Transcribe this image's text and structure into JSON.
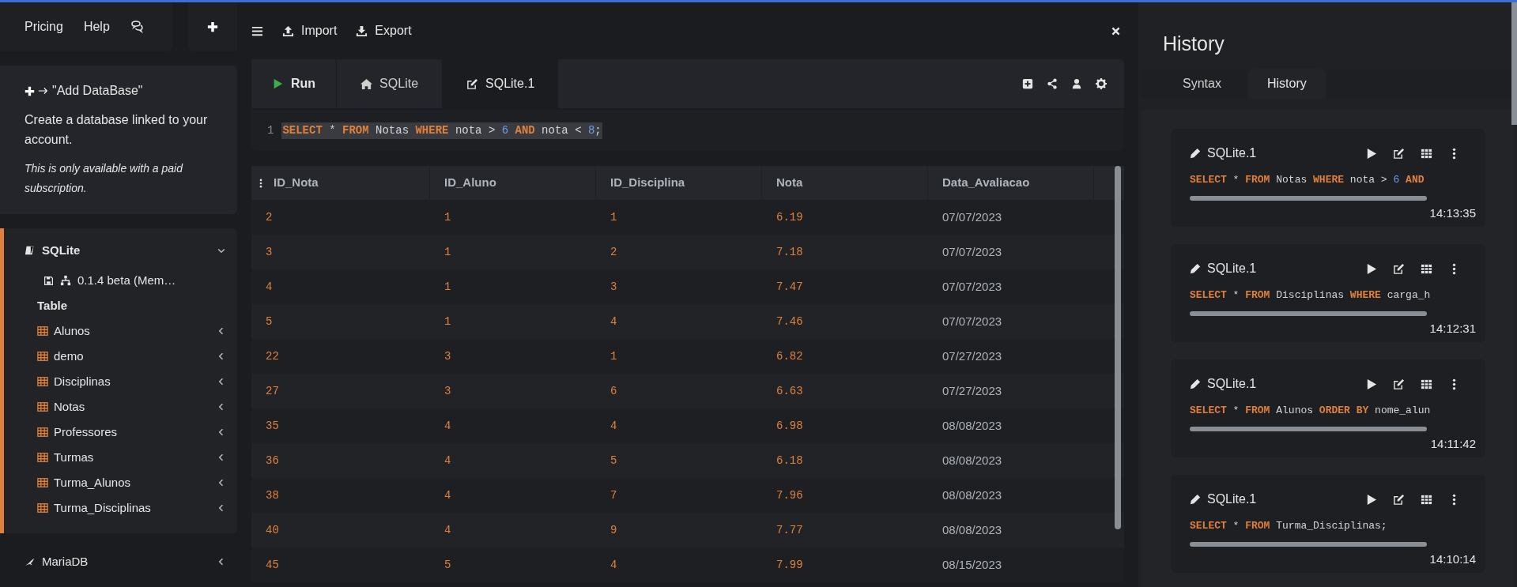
{
  "sidebar": {
    "nav": [
      {
        "kind": "text",
        "label": "Pricing"
      },
      {
        "kind": "text",
        "label": "Help"
      },
      {
        "kind": "icon"
      }
    ],
    "info": {
      "title": "\"Add DataBase\"",
      "text": "Create a database linked to your account.",
      "note": "This is only available with a paid subscription."
    },
    "databases": [
      {
        "name": "SQLite",
        "expanded": true,
        "version": "0.1.4 beta (Mem…",
        "section": "Table",
        "tables": [
          "Alunos",
          "demo",
          "Disciplinas",
          "Notas",
          "Professores",
          "Turmas",
          "Turma_Alunos",
          "Turma_Disciplinas"
        ]
      },
      {
        "name": "MariaDB",
        "expanded": false
      }
    ]
  },
  "toolbar": {
    "buttons": [
      {
        "kind": "import",
        "label": "Import"
      },
      {
        "kind": "export",
        "label": "Export"
      }
    ]
  },
  "editor": {
    "run_label": "Run",
    "tabs": [
      {
        "kind": "home",
        "label": "SQLite",
        "selected": false
      },
      {
        "kind": "edit",
        "label": "SQLite.1",
        "selected": true
      }
    ],
    "line_number": "1",
    "code": [
      {
        "kind": "keyword",
        "text": "SELECT"
      },
      {
        "kind": "text",
        "text": " * "
      },
      {
        "kind": "keyword",
        "text": "FROM"
      },
      {
        "kind": "text",
        "text": " Notas "
      },
      {
        "kind": "keyword",
        "text": "WHERE"
      },
      {
        "kind": "text",
        "text": " nota > "
      },
      {
        "kind": "number",
        "text": "6"
      },
      {
        "kind": "keyword",
        "text": " AND"
      },
      {
        "kind": "text",
        "text": " nota < "
      },
      {
        "kind": "number",
        "text": "8"
      },
      {
        "kind": "text",
        "text": ";"
      }
    ]
  },
  "table": {
    "columns": [
      "ID_Nota",
      "ID_Aluno",
      "ID_Disciplina",
      "Nota",
      "Data_Avaliacao"
    ],
    "rows": [
      [
        "2",
        "1",
        "1",
        "6.19",
        "07/07/2023"
      ],
      [
        "3",
        "1",
        "2",
        "7.18",
        "07/07/2023"
      ],
      [
        "4",
        "1",
        "3",
        "7.47",
        "07/07/2023"
      ],
      [
        "5",
        "1",
        "4",
        "7.46",
        "07/07/2023"
      ],
      [
        "22",
        "3",
        "1",
        "6.82",
        "07/27/2023"
      ],
      [
        "27",
        "3",
        "6",
        "6.63",
        "07/27/2023"
      ],
      [
        "35",
        "4",
        "4",
        "6.98",
        "08/08/2023"
      ],
      [
        "36",
        "4",
        "5",
        "6.18",
        "08/08/2023"
      ],
      [
        "38",
        "4",
        "7",
        "7.96",
        "08/08/2023"
      ],
      [
        "40",
        "4",
        "9",
        "7.77",
        "08/08/2023"
      ],
      [
        "45",
        "5",
        "4",
        "7.99",
        "08/15/2023"
      ]
    ]
  },
  "history": {
    "title": "History",
    "tabs": [
      {
        "label": "Syntax",
        "selected": false
      },
      {
        "label": "History",
        "selected": true
      }
    ],
    "entries": [
      {
        "name": "SQLite.1",
        "time": "14:13:35",
        "code": [
          {
            "kind": "keyword",
            "text": "SELECT"
          },
          {
            "kind": "text",
            "text": " * "
          },
          {
            "kind": "keyword",
            "text": "FROM"
          },
          {
            "kind": "text",
            "text": " Notas "
          },
          {
            "kind": "keyword",
            "text": "WHERE"
          },
          {
            "kind": "text",
            "text": " nota > "
          },
          {
            "kind": "number",
            "text": "6"
          },
          {
            "kind": "keyword",
            "text": " AND"
          }
        ]
      },
      {
        "name": "SQLite.1",
        "time": "14:12:31",
        "code": [
          {
            "kind": "keyword",
            "text": "SELECT"
          },
          {
            "kind": "text",
            "text": " * "
          },
          {
            "kind": "keyword",
            "text": "FROM"
          },
          {
            "kind": "text",
            "text": " Disciplinas "
          },
          {
            "kind": "keyword",
            "text": "WHERE"
          },
          {
            "kind": "text",
            "text": " carga_h"
          }
        ]
      },
      {
        "name": "SQLite.1",
        "time": "14:11:42",
        "code": [
          {
            "kind": "keyword",
            "text": "SELECT"
          },
          {
            "kind": "text",
            "text": " * "
          },
          {
            "kind": "keyword",
            "text": "FROM"
          },
          {
            "kind": "text",
            "text": " Alunos "
          },
          {
            "kind": "keyword",
            "text": "ORDER BY"
          },
          {
            "kind": "text",
            "text": " nome_alun"
          }
        ]
      },
      {
        "name": "SQLite.1",
        "time": "14:10:14",
        "code": [
          {
            "kind": "keyword",
            "text": "SELECT"
          },
          {
            "kind": "text",
            "text": " * "
          },
          {
            "kind": "keyword",
            "text": "FROM"
          },
          {
            "kind": "text",
            "text": " Turma_Disciplinas;"
          }
        ]
      }
    ]
  }
}
